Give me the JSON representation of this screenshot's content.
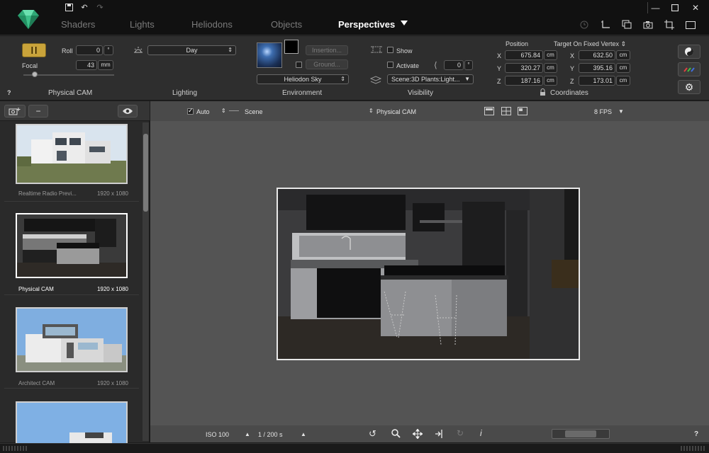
{
  "tabs": [
    {
      "label": "Shaders",
      "active": false
    },
    {
      "label": "Lights",
      "active": false
    },
    {
      "label": "Heliodons",
      "active": false
    },
    {
      "label": "Objects",
      "active": false
    },
    {
      "label": "Perspectives",
      "active": true
    }
  ],
  "colors": {
    "brand": "#3ec08a",
    "accent": "#c9a33a",
    "panel": "#2e2e2e",
    "viewport": "#545454"
  },
  "physical_cam": {
    "roll_label": "Roll",
    "roll_value": "0",
    "roll_unit": "°",
    "focal_label": "Focal",
    "focal_value": "43",
    "focal_unit": "mm",
    "group_label": "Physical CAM",
    "help": "?"
  },
  "lighting": {
    "preset": "Day",
    "group_label": "Lighting"
  },
  "environment": {
    "insertion_label": "Insertion...",
    "ground_label": "Ground...",
    "sky_select": "Heliodon Sky",
    "group_label": "Environment"
  },
  "visibility": {
    "show_label": "Show",
    "activate_label": "Activate",
    "angle_value": "0",
    "angle_unit": "°",
    "scene_select": "Scene:3D Plants:Light...",
    "group_label": "Visibility"
  },
  "coordinates": {
    "position_label": "Position",
    "target_label": "Target On Fixed Vertex",
    "axes": [
      "X",
      "Y",
      "Z"
    ],
    "position": [
      "675.84",
      "320.27",
      "187.16"
    ],
    "target": [
      "632.50",
      "395.16",
      "173.01"
    ],
    "unit": "cm",
    "group_label": "Coordinates"
  },
  "sidebar": {
    "cards": [
      {
        "name": "Realtime Radio Previ...",
        "size": "1920 x 1080",
        "selected": false
      },
      {
        "name": "Physical CAM",
        "size": "1920 x 1080",
        "selected": true
      },
      {
        "name": "Architect CAM",
        "size": "1920 x 1080",
        "selected": false
      },
      {
        "name": "",
        "size": "",
        "selected": false
      }
    ]
  },
  "viewport": {
    "auto_label": "Auto",
    "scene_label": "Scene",
    "camera_label": "Physical CAM",
    "fps_label": "8 FPS",
    "iso_label": "ISO 100",
    "shutter_label": "1 / 200 s",
    "help": "?"
  }
}
